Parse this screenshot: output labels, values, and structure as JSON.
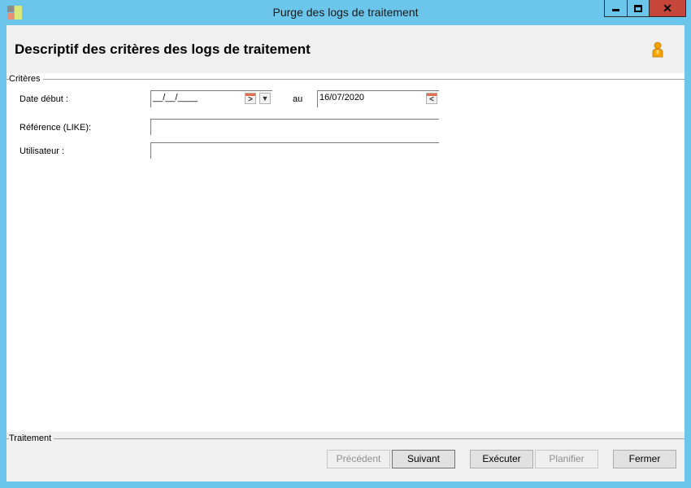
{
  "window": {
    "title": "Purge des logs de traitement",
    "close_glyph": "✕"
  },
  "header": {
    "title": "Descriptif des critères des logs de traitement",
    "help_icon": "person-help-icon"
  },
  "criteria": {
    "group_label": "Critères",
    "date_debut_label": "Date début :",
    "date_debut_value": "__/__/____",
    "au_label": "au",
    "date_fin_value": "16/07/2020",
    "reference_label": "Référence (LIKE):",
    "reference_value": "",
    "utilisateur_label": "Utilisateur :",
    "utilisateur_value": ""
  },
  "icons": {
    "forward_glyph": ">",
    "back_glyph": "<",
    "dropdown_glyph": "▼"
  },
  "footer": {
    "group_label": "Traitement",
    "buttons": {
      "precedent": "Précédent",
      "suivant": "Suivant",
      "executer": "Exécuter",
      "planifier": "Planifier",
      "fermer": "Fermer"
    }
  },
  "colors": {
    "title_bar": "#6cc5ea",
    "close_button": "#c7463c",
    "panel": "#f0f0f0"
  }
}
